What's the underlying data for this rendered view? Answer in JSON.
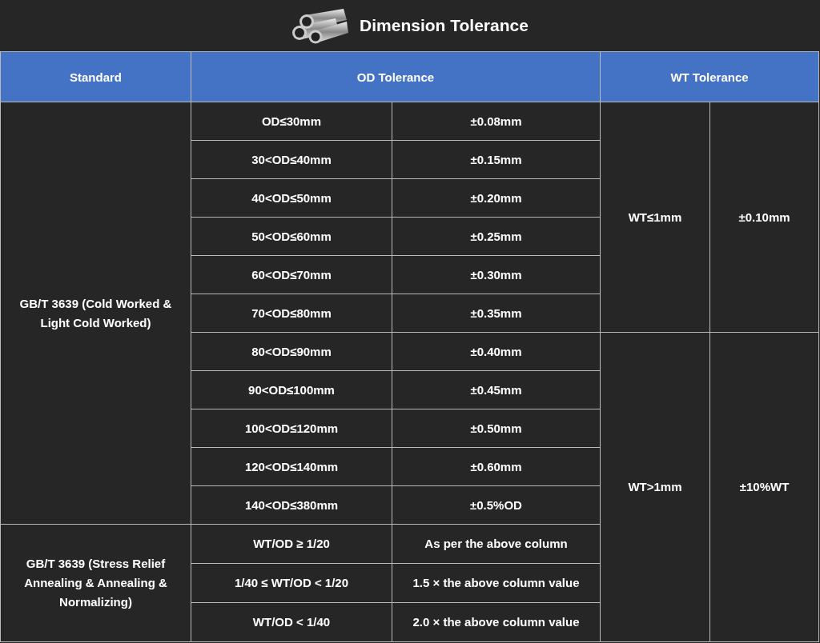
{
  "title": "Dimension Tolerance",
  "columns": [
    "Standard",
    "OD Tolerance",
    "WT Tolerance"
  ],
  "groups": [
    {
      "standard": "GB/T 3639 (Cold Worked & Light Cold Worked)",
      "rows": [
        {
          "condition": "OD≤30mm",
          "tolerance": "±0.08mm"
        },
        {
          "condition": "30<OD≤40mm",
          "tolerance": "±0.15mm"
        },
        {
          "condition": "40<OD≤50mm",
          "tolerance": "±0.20mm"
        },
        {
          "condition": "50<OD≤60mm",
          "tolerance": "±0.25mm"
        },
        {
          "condition": "60<OD≤70mm",
          "tolerance": "±0.30mm"
        },
        {
          "condition": "70<OD≤80mm",
          "tolerance": "±0.35mm"
        },
        {
          "condition": "80<OD≤90mm",
          "tolerance": "±0.40mm"
        },
        {
          "condition": "90<OD≤100mm",
          "tolerance": "±0.45mm"
        },
        {
          "condition": "100<OD≤120mm",
          "tolerance": "±0.50mm"
        },
        {
          "condition": "120<OD≤140mm",
          "tolerance": "±0.60mm"
        },
        {
          "condition": "140<OD≤380mm",
          "tolerance": "±0.5%OD"
        }
      ]
    },
    {
      "standard": "GB/T 3639 (Stress Relief Annealing & Annealing & Normalizing)",
      "rows": [
        {
          "condition": "WT/OD ≥ 1/20",
          "tolerance": "As per the above column"
        },
        {
          "condition": "1/40 ≤ WT/OD < 1/20",
          "tolerance": "1.5 × the above column value"
        },
        {
          "condition": "WT/OD < 1/40",
          "tolerance": "2.0 × the above column value"
        }
      ]
    }
  ],
  "wt_tolerance": [
    {
      "condition": "WT≤1mm",
      "tolerance": "±0.10mm"
    },
    {
      "condition": "WT>1mm",
      "tolerance": "±10%WT"
    }
  ]
}
